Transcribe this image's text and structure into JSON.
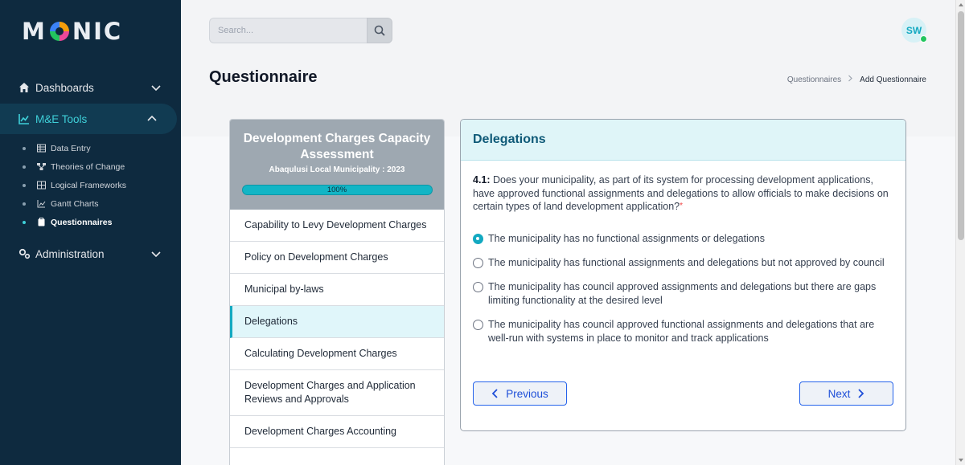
{
  "app": {
    "logo_text_left": "M",
    "logo_text_right": "NIC"
  },
  "search": {
    "placeholder": "Search..."
  },
  "user": {
    "initials": "SW",
    "status_color": "#22c55e"
  },
  "colors": {
    "sidebar_bg": "#0e2a3f",
    "accent": "#13a9c1",
    "primary_button": "#2563eb"
  },
  "sidebar": {
    "dashboards": "Dashboards",
    "me_tools": "M&E Tools",
    "sub_items": [
      {
        "label": "Data Entry",
        "icon": "table-icon"
      },
      {
        "label": "Theories of Change",
        "icon": "sitemap-icon"
      },
      {
        "label": "Logical Frameworks",
        "icon": "grid-icon"
      },
      {
        "label": "Gantt Charts",
        "icon": "chart-icon"
      },
      {
        "label": "Questionnaires",
        "icon": "clipboard-icon"
      }
    ],
    "administration": "Administration"
  },
  "page": {
    "title": "Questionnaire"
  },
  "breadcrumb": {
    "link": "Questionnaires",
    "current": "Add Questionnaire"
  },
  "assessment": {
    "title": "Development Charges Capacity Assessment",
    "subtitle": "Abaqulusi Local Municipality : 2023",
    "progress_label": "100%",
    "progress_value": 1.0,
    "sections": [
      "Capability to Levy Development Charges",
      "Policy on Development Charges",
      "Municipal by-laws",
      "Delegations",
      "Calculating Development Charges",
      "Development Charges and Application Reviews and Approvals",
      "Development Charges Accounting"
    ],
    "active_section": "Delegations"
  },
  "question": {
    "section_title": "Delegations",
    "number": "4.1:",
    "text": "Does your municipality, as part of its system for processing development applications, have approved functional assignments and delegations to allow officials to make decisions on certain types of land development application?",
    "required_mark": "*",
    "options": [
      "The municipality has no functional assignments or delegations",
      "The municipality has functional assignments and delegations but not approved by council",
      "The municipality has council approved assignments and delegations but there are gaps limiting functionality at the desired level",
      "The municipality has council approved functional assignments and delegations that are well-run with systems in place to monitor and track applications"
    ],
    "selected_index": 0
  },
  "buttons": {
    "previous": "Previous",
    "next": "Next"
  }
}
